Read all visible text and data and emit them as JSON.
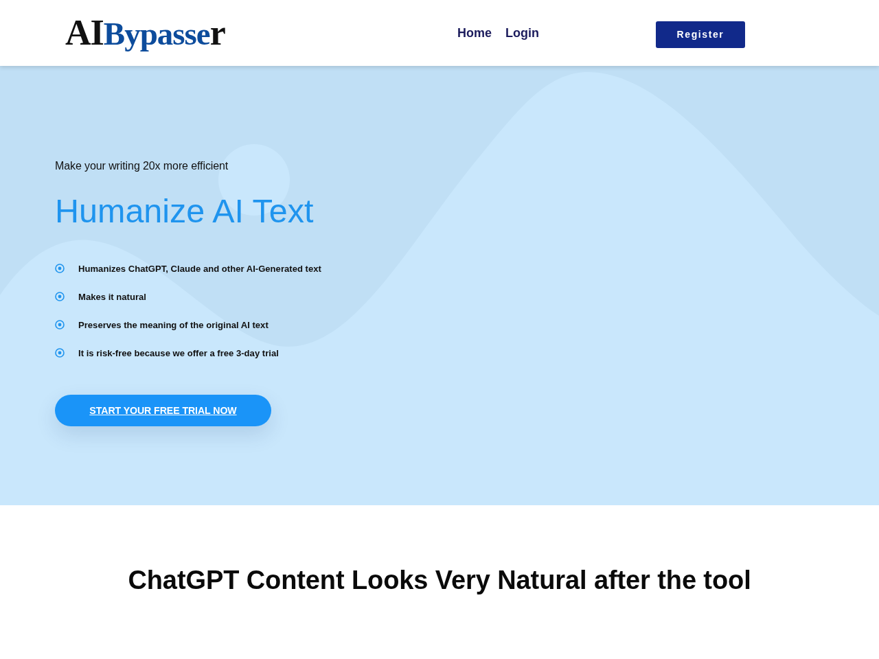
{
  "header": {
    "logo": {
      "parts": [
        {
          "text": "AI",
          "color": "#111111"
        },
        {
          "text": "Bypasse",
          "color": "#0d4c9c"
        },
        {
          "text": "r",
          "color": "#111111"
        }
      ]
    },
    "nav": [
      "Home",
      "Login"
    ],
    "register_button": "Register"
  },
  "hero": {
    "tagline": "Make your writing 20x more efficient",
    "title": "Humanize AI Text",
    "features": [
      "Humanizes ChatGPT, Claude and other AI-Generated text",
      "Makes it natural",
      "Preserves the meaning of the original AI text",
      "It is risk-free because we offer a free 3-day trial"
    ],
    "cta_button": "START YOUR FREE TRIAL NOW"
  },
  "section": {
    "title": "ChatGPT Content Looks Very Natural after the tool"
  }
}
